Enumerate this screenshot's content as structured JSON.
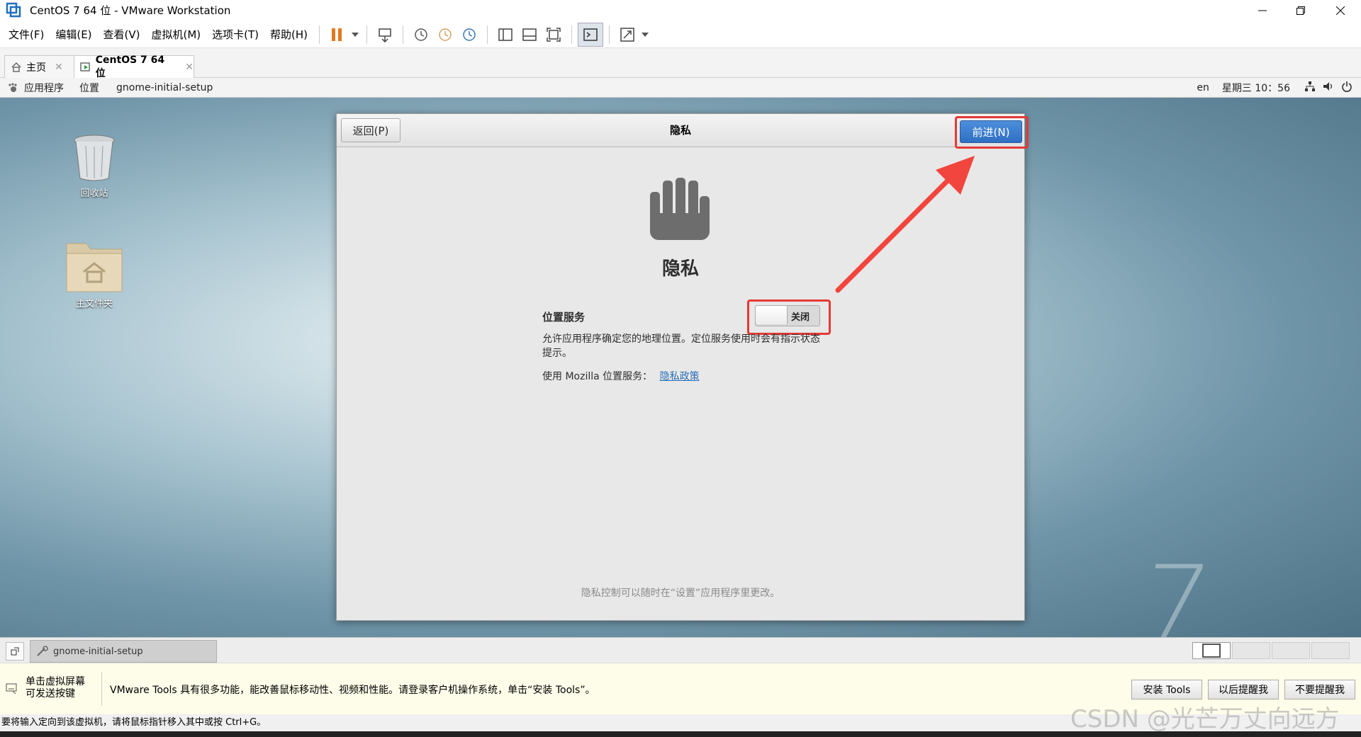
{
  "window": {
    "title": "CentOS 7 64 位 - VMware Workstation"
  },
  "menu": [
    "文件(F)",
    "编辑(E)",
    "查看(V)",
    "虚拟机(M)",
    "选项卡(T)",
    "帮助(H)"
  ],
  "tabs": [
    {
      "label": "主页"
    },
    {
      "label": "CentOS 7 64 位"
    }
  ],
  "gnome_bar": {
    "applications": "应用程序",
    "places": "位置",
    "current_app": "gnome-initial-setup",
    "input_method": "en",
    "clock": "星期三 10：56"
  },
  "desktop": {
    "trash_label": "回收站",
    "home_label": "主文件夹",
    "watermark_number": "7"
  },
  "dialog": {
    "back_button": "返回(P)",
    "header_title": "隐私",
    "next_button": "前进(N)",
    "big_title": "隐私",
    "location_label": "位置服务",
    "toggle_state": "关闭",
    "description": "允许应用程序确定您的地理位置。定位服务使用时会有指示状态提示。",
    "mozilla_text": "使用  Mozilla 位置服务：",
    "privacy_link": "隐私政策",
    "footer_note": "隐私控制可以随时在“设置”应用程序里更改。"
  },
  "vm_taskbar": {
    "task_label": "gnome-initial-setup"
  },
  "tools_bar": {
    "hint_line1": "单击虚拟屏幕",
    "hint_line2": "可发送按键",
    "message": "VMware Tools 具有很多功能，能改善鼠标移动性、视频和性能。请登录客户机操作系统，单击“安装 Tools”。",
    "install_button": "安装 Tools",
    "remind_later_button": "以后提醒我",
    "never_remind_button": "不要提醒我"
  },
  "status_bar": {
    "text": "要将输入定向到该虚拟机，请将鼠标指针移入其中或按 Ctrl+G。"
  },
  "watermark": "CSDN @光芒万丈向远方",
  "colors": {
    "primary_button": "#3a7fd0",
    "highlight_red": "#e53935",
    "arrow_red": "#f2453d"
  }
}
